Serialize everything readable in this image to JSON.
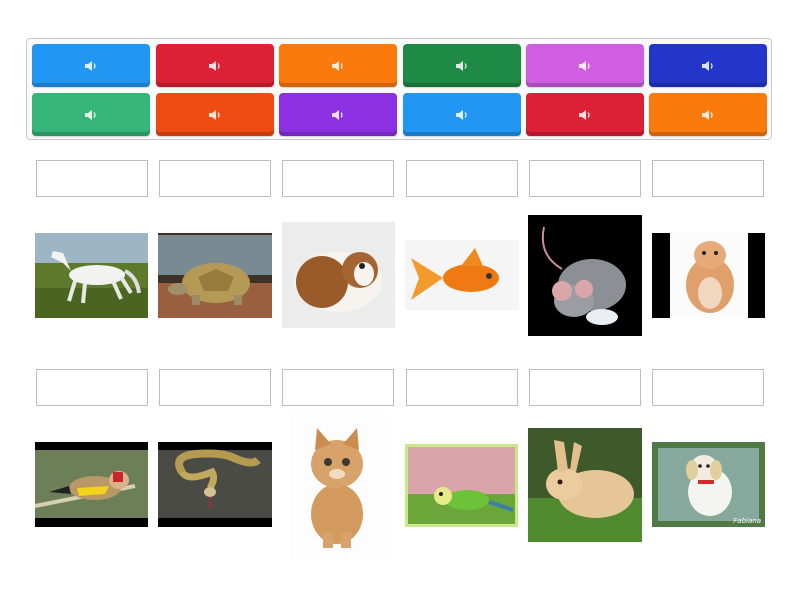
{
  "audio_tiles": [
    {
      "icon": "speaker-icon",
      "color": "#2196f3"
    },
    {
      "icon": "speaker-icon",
      "color": "#dc2036"
    },
    {
      "icon": "speaker-icon",
      "color": "#fb7a0c"
    },
    {
      "icon": "speaker-icon",
      "color": "#1f8a45"
    },
    {
      "icon": "speaker-icon",
      "color": "#cf5fe0"
    },
    {
      "icon": "speaker-icon",
      "color": "#2436c9"
    },
    {
      "icon": "speaker-icon",
      "color": "#35b577"
    },
    {
      "icon": "speaker-icon",
      "color": "#f04b12"
    },
    {
      "icon": "speaker-icon",
      "color": "#8b31e2"
    },
    {
      "icon": "speaker-icon",
      "color": "#2196f3"
    },
    {
      "icon": "speaker-icon",
      "color": "#dc2036"
    },
    {
      "icon": "speaker-icon",
      "color": "#fb7a0c"
    }
  ],
  "images": [
    {
      "subject": "horse"
    },
    {
      "subject": "tortoise"
    },
    {
      "subject": "guinea-pig"
    },
    {
      "subject": "goldfish"
    },
    {
      "subject": "mouse"
    },
    {
      "subject": "hamster"
    },
    {
      "subject": "goldfinch"
    },
    {
      "subject": "snake"
    },
    {
      "subject": "kitten"
    },
    {
      "subject": "budgie"
    },
    {
      "subject": "rabbit"
    },
    {
      "subject": "puppy"
    }
  ],
  "answer_slots_count": 12,
  "watermark": "Fabiana"
}
